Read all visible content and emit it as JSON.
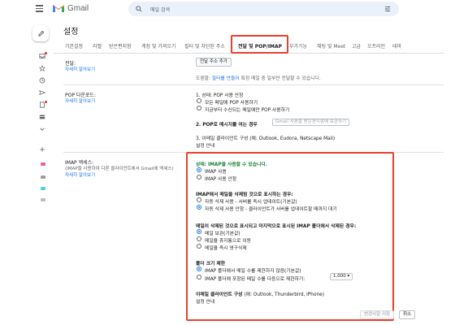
{
  "header": {
    "app_name": "Gmail",
    "search_placeholder": "메일 검색"
  },
  "colors": {
    "accent": "#1a73e8",
    "highlight": "#e8412c",
    "status_green": "#188038"
  },
  "settings": {
    "title": "설정",
    "tabs": [
      {
        "label": "기본설정"
      },
      {
        "label": "라벨"
      },
      {
        "label": "받은편지함"
      },
      {
        "label": "계정 및 가져오기"
      },
      {
        "label": "필터 및 차단된 주소"
      },
      {
        "label": "전달 및 POP/IMAP"
      },
      {
        "label": "부가기능"
      },
      {
        "label": "채팅 및 Meet"
      },
      {
        "label": "고급"
      },
      {
        "label": "오프라인"
      },
      {
        "label": "테마"
      }
    ]
  },
  "forwarding": {
    "label": "전달:",
    "learn_more": "자세히 알아보기",
    "add_button": "전달 주소 추가",
    "tip_prefix": "도움말:",
    "tip_link": "필터를 만들어",
    "tip_suffix": "특정 메일 중 일부만 전달할 수 있습니다."
  },
  "pop": {
    "label": "POP 다운로드:",
    "learn_more": "자세히 알아보기",
    "status": "1. 상태: POP 사용 안함",
    "option_all": "모든 메일에 POP 사용하기",
    "option_new": "지금부터 수신되는 메일에만 POP 사용하기",
    "step2_label": "2. POP로 메시지를 여는 경우",
    "step2_select": "Gmail 사본을 받은편지함에 보관하기",
    "step3_label": "3. 이메일 클라이언트 구성",
    "step3_hint": "(예: Outlook, Eudora, Netscape Mail)",
    "setup_link": "설정 안내"
  },
  "imap": {
    "label": "IMAP 액세스:",
    "sub": "(IMAP을 사용하여 다른 클라이언트에서 Gmail에 액세스)",
    "learn_more": "자세히 알아보기",
    "status": "상태: IMAP을 사용할 수 있습니다.",
    "enable": "IMAP 사용",
    "disable": "IMAP 사용 안함",
    "delete_heading": "IMAP에서 메일을 삭제됨 것으로 표시하는 경우:",
    "delete_opt1": "자동 삭제 사용 - 서버를 즉시 업데이트(기본값)",
    "delete_opt2": "자동 삭제 사용 안함 - 클라이언트가 서버를 업데이트할 때까지 대기",
    "expunge_heading": "메일이 삭제된 것으로 표시되고 마지막으로 표시된 IMAP 폴더에서 삭제된 경우:",
    "expunge_opt1": "메일 보관(기본값)",
    "expunge_opt2": "메일을 휴지통으로 이동",
    "expunge_opt3": "메일을 즉시 영구삭제",
    "folder_heading": "폴더 크기 제한",
    "folder_opt1": "IMAP 폴더에서 메일 수를 제한하지 않음(기본값)",
    "folder_opt2_prefix": "IMAP 폴더에 포함된 메일 수를 다음으로 제한하기:",
    "folder_opt2_value": "1,000",
    "client_heading": "이메일 클라이언트 구성",
    "client_hint": "(예: Outlook, Thunderbird, iPhone)",
    "setup_link": "설정 안내"
  },
  "footer": {
    "save": "변경사항 저장",
    "cancel": "취소"
  }
}
